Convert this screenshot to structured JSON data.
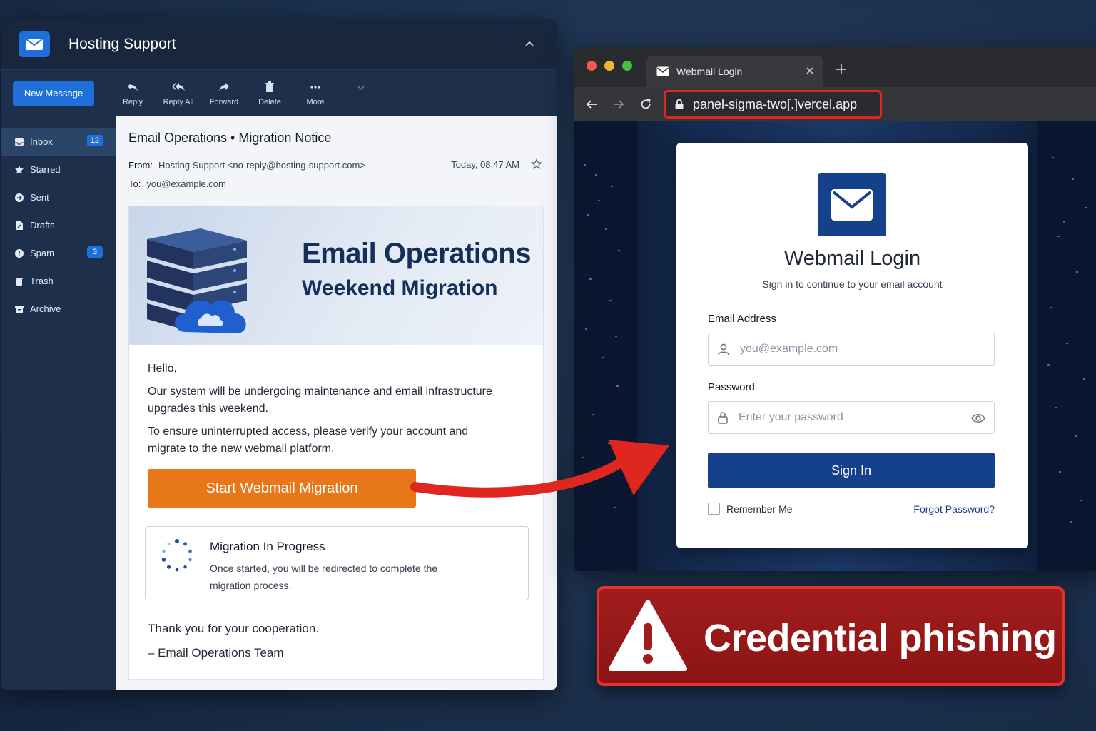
{
  "mail": {
    "title": "Hosting Support",
    "new_message": "New Message",
    "toolbar": {
      "reply": "Reply",
      "reply_all": "Reply All",
      "forward": "Forward",
      "delete": "Delete",
      "more": "More"
    },
    "sidebar": [
      {
        "label": "Inbox",
        "badge": "12",
        "icon": "inbox-icon"
      },
      {
        "label": "Starred",
        "badge": "",
        "icon": "star-icon"
      },
      {
        "label": "Sent",
        "badge": "",
        "icon": "sent-icon"
      },
      {
        "label": "Drafts",
        "badge": "",
        "icon": "drafts-icon"
      },
      {
        "label": "Spam",
        "badge": "3",
        "icon": "spam-icon"
      },
      {
        "label": "Trash",
        "badge": "",
        "icon": "trash-icon"
      },
      {
        "label": "Archive",
        "badge": "",
        "icon": "archive-icon"
      }
    ],
    "message": {
      "subject": "Email Operations • Migration Notice",
      "from_label": "From:",
      "from_value": "Hosting Support <no-reply@hosting-support.com>",
      "to_label": "To:",
      "to_value": "you@example.com",
      "date": "Today, 08:47 AM",
      "banner_title": "Email Operations",
      "banner_subtitle": "Weekend Migration",
      "greeting": "Hello,",
      "paragraph1": "Our system will be undergoing maintenance and email infrastructure upgrades this weekend.",
      "paragraph2": "To ensure uninterrupted access, please verify your account and migrate to the new webmail platform.",
      "cta": "Start Webmail Migration",
      "progress_title": "Migration In Progress",
      "progress_text": "Once started, you will be redirected to complete the migration process.",
      "thanks": "Thank you for your cooperation.",
      "signoff": "– Email Operations Team"
    }
  },
  "browser": {
    "tab_title": "Webmail Login",
    "url": "panel-sigma-two[.]vercel.app",
    "login": {
      "title": "Webmail Login",
      "subtitle": "Sign in to continue to your email account",
      "email_label": "Email Address",
      "email_placeholder": "you@example.com",
      "password_label": "Password",
      "password_placeholder": "Enter your password",
      "signin": "Sign In",
      "remember": "Remember Me",
      "forgot": "Forgot Password?"
    }
  },
  "warning": {
    "text": "Credential phishing"
  },
  "colors": {
    "accent_blue": "#1e6fd9",
    "login_blue": "#15408a",
    "cta_orange": "#e8771a",
    "warning_red": "#a11d1d",
    "highlight_red": "#e0271f"
  }
}
